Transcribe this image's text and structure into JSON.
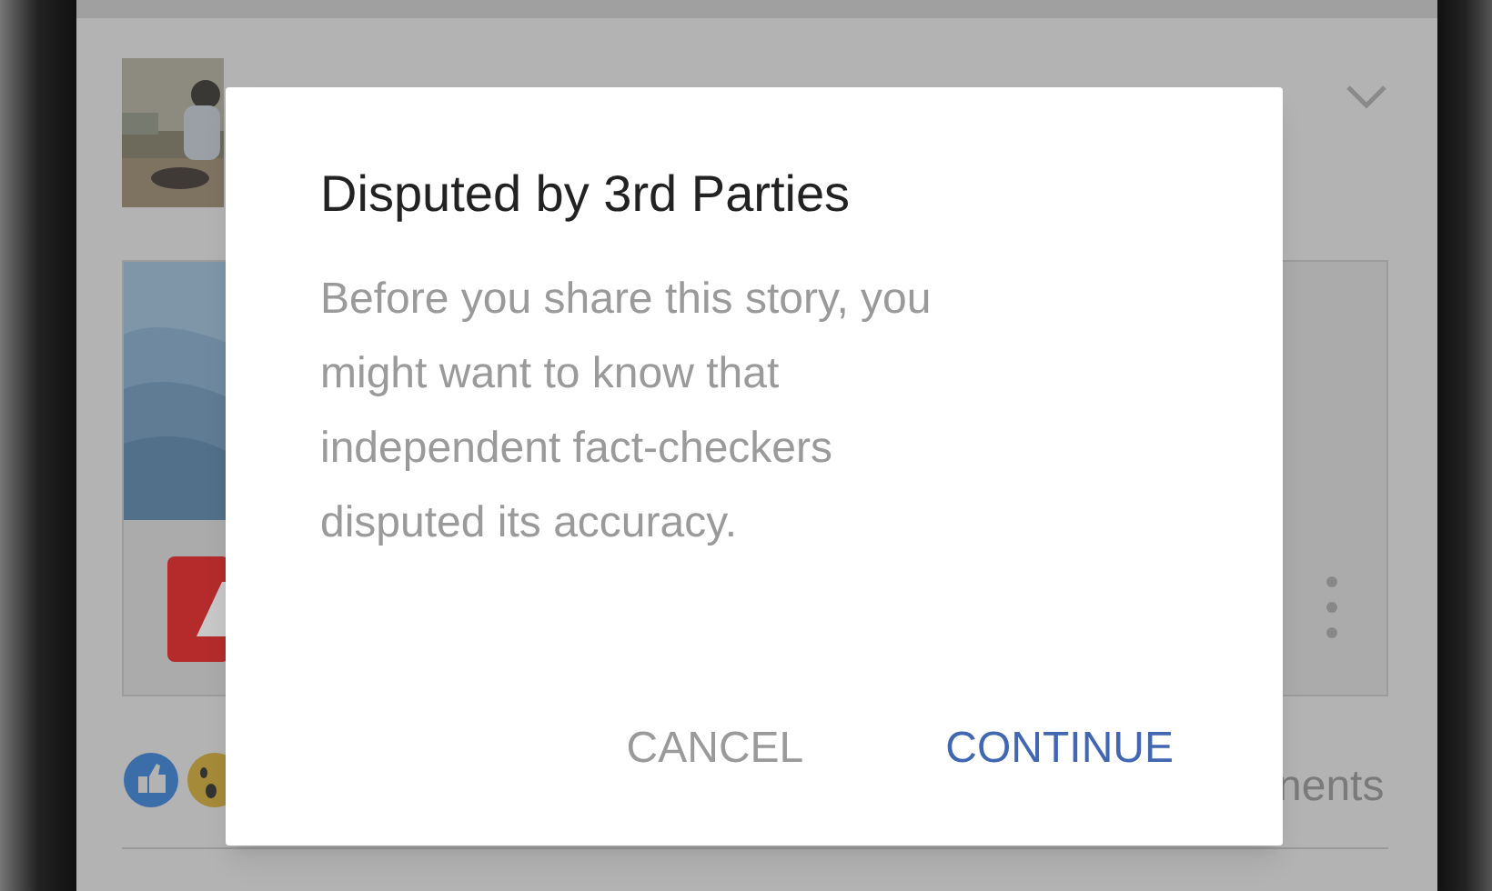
{
  "background_post": {
    "comments_text": "nents"
  },
  "dialog": {
    "title": "Disputed by 3rd Parties",
    "message": "Before you share this story, you might want to know that independent fact-checkers disputed its accuracy.",
    "buttons": [
      {
        "label": "CANCEL",
        "kind": "secondary"
      },
      {
        "label": "CONTINUE",
        "kind": "primary"
      }
    ]
  }
}
